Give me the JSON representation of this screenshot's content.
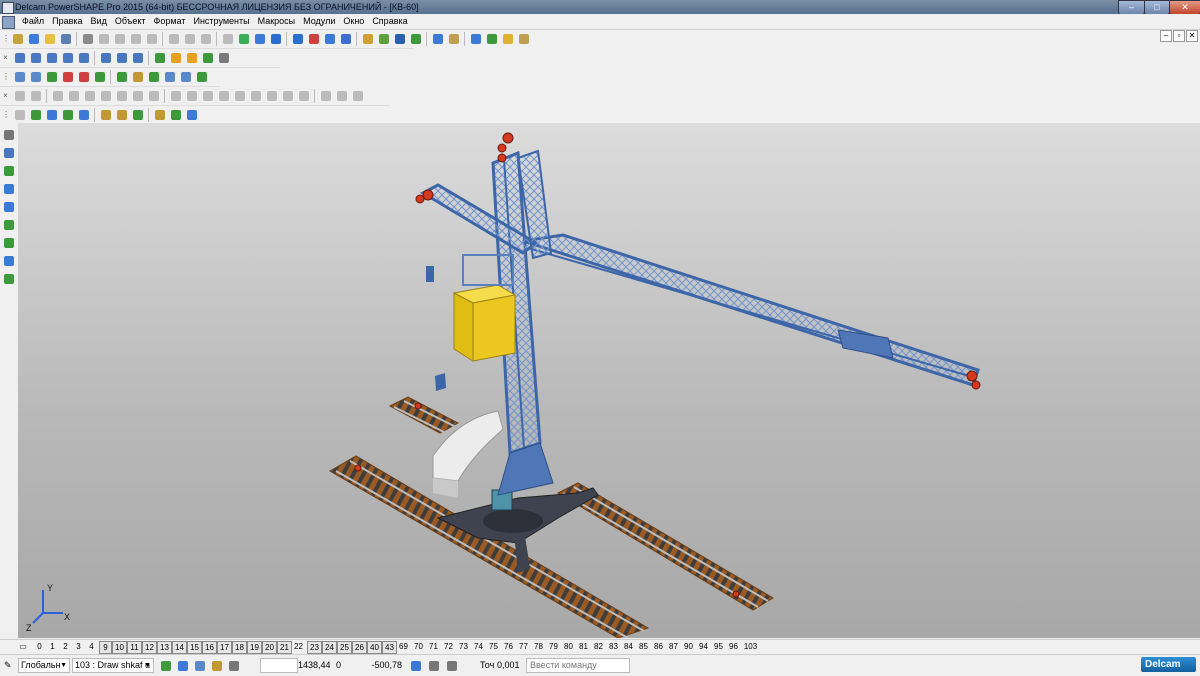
{
  "window": {
    "title": "Delcam PowerSHAPE Pro 2015 (64-bit) БЕССРОЧНАЯ ЛИЦЕНЗИЯ БЕЗ ОГРАНИЧЕНИЙ - [КВ-60]",
    "minimize": "–",
    "maximize": "□",
    "close": "✕"
  },
  "menu": [
    "Файл",
    "Правка",
    "Вид",
    "Объект",
    "Формат",
    "Инструменты",
    "Макросы",
    "Модули",
    "Окно",
    "Справка"
  ],
  "mdi_buttons": [
    "–",
    "▫",
    "✕"
  ],
  "toolbars": {
    "row1_grip": "⋮",
    "row2_close": "×",
    "row3_grip": "⋮",
    "row4_close": "×",
    "row5_grip": "⋮"
  },
  "toolbar_icons": {
    "row1": [
      "#c8a23c",
      "#3b7dd8",
      "#e8c040",
      "#5a7fb0",
      "#8a8a8a",
      "#bbbbbb",
      "#bbbbbb",
      "#bbbbbb",
      "#bbbbbb",
      "#bbbbbb",
      "#bbbbbb",
      "#bbbbbb",
      "#bbbbbb",
      "#3cae5a",
      "#3c7ad8",
      "#2a6fd0",
      "#2a6fd0",
      "#d04040",
      "#3c7ad8",
      "#3c6fd0",
      "#d0a030",
      "#60a040",
      "#2a5fb0",
      "#3c9a3c",
      "#3c7ad8",
      "#c0a050",
      "#3c7ad8",
      "#3c9a3c",
      "#e0b030",
      "#c0a050"
    ],
    "row2": [
      "#4a78c0",
      "#4a78c0",
      "#4a78c0",
      "#4a78c0",
      "#4a78c0",
      "#4a78c0",
      "#4a78c0",
      "#4a78c0",
      "#3c9a3c",
      "#e8a020",
      "#e8a020",
      "#3c9a3c",
      "#7a7a7a"
    ],
    "row3": [
      "#5a88c8",
      "#5a88c8",
      "#3c9a3c",
      "#d04040",
      "#d04040",
      "#3c9a3c",
      "#3c9a3c",
      "#c09a30",
      "#3c9a3c",
      "#5a88c8",
      "#5a88c8",
      "#3c9a3c"
    ],
    "row4": [
      "#bbbbbb",
      "#bbbbbb",
      "#bbbbbb",
      "#bbbbbb",
      "#bbbbbb",
      "#bbbbbb",
      "#bbbbbb",
      "#bbbbbb",
      "#bbbbbb",
      "#bbbbbb",
      "#bbbbbb",
      "#bbbbbb",
      "#bbbbbb",
      "#bbbbbb",
      "#bbbbbb",
      "#bbbbbb",
      "#bbbbbb",
      "#bbbbbb",
      "#bbbbbb",
      "#bbbbbb",
      "#bbbbbb"
    ],
    "row5": [
      "#bbbbbb",
      "#3c9a3c",
      "#3c7ad8",
      "#3c9a3c",
      "#3c7ad8",
      "#c09a30",
      "#c09a30",
      "#3c9a3c",
      "#c09a30",
      "#3c9a3c",
      "#3c7ad8"
    ],
    "left": [
      "#777777",
      "#4a78c0",
      "#3c9a3c",
      "#3c7ad8",
      "#3c7ad8",
      "#3c9a3c",
      "#3c9a3c",
      "#3c7ad8",
      "#3c9a3c"
    ]
  },
  "axis_triad": {
    "y": "Y",
    "x": "X",
    "z": "Z"
  },
  "levels": [
    {
      "n": "0",
      "boxed": false
    },
    {
      "n": "1",
      "boxed": false
    },
    {
      "n": "2",
      "boxed": false
    },
    {
      "n": "3",
      "boxed": false
    },
    {
      "n": "4",
      "boxed": false
    },
    {
      "n": "9",
      "boxed": true
    },
    {
      "n": "10",
      "boxed": true
    },
    {
      "n": "11",
      "boxed": true
    },
    {
      "n": "12",
      "boxed": true
    },
    {
      "n": "13",
      "boxed": true
    },
    {
      "n": "14",
      "boxed": true
    },
    {
      "n": "15",
      "boxed": true
    },
    {
      "n": "16",
      "boxed": true
    },
    {
      "n": "17",
      "boxed": true
    },
    {
      "n": "18",
      "boxed": true
    },
    {
      "n": "19",
      "boxed": true
    },
    {
      "n": "20",
      "boxed": true
    },
    {
      "n": "21",
      "boxed": true
    },
    {
      "n": "22",
      "boxed": false
    },
    {
      "n": "23",
      "boxed": true
    },
    {
      "n": "24",
      "boxed": true
    },
    {
      "n": "25",
      "boxed": true
    },
    {
      "n": "26",
      "boxed": true
    },
    {
      "n": "40",
      "boxed": true
    },
    {
      "n": "43",
      "boxed": true
    },
    {
      "n": "69",
      "boxed": false
    },
    {
      "n": "70",
      "boxed": false
    },
    {
      "n": "71",
      "boxed": false
    },
    {
      "n": "72",
      "boxed": false
    },
    {
      "n": "73",
      "boxed": false
    },
    {
      "n": "74",
      "boxed": false
    },
    {
      "n": "75",
      "boxed": false
    },
    {
      "n": "76",
      "boxed": false
    },
    {
      "n": "77",
      "boxed": false
    },
    {
      "n": "78",
      "boxed": false
    },
    {
      "n": "79",
      "boxed": false
    },
    {
      "n": "80",
      "boxed": false
    },
    {
      "n": "81",
      "boxed": false
    },
    {
      "n": "82",
      "boxed": false
    },
    {
      "n": "83",
      "boxed": false
    },
    {
      "n": "84",
      "boxed": false
    },
    {
      "n": "85",
      "boxed": false
    },
    {
      "n": "86",
      "boxed": false
    },
    {
      "n": "87",
      "boxed": false
    },
    {
      "n": "90",
      "boxed": false
    },
    {
      "n": "94",
      "boxed": false
    },
    {
      "n": "95",
      "boxed": false
    },
    {
      "n": "96",
      "boxed": false
    },
    {
      "n": "103",
      "boxed": false
    }
  ],
  "status": {
    "workplane": "Глобальн",
    "level": "103 : Draw shkaf u",
    "x": "1438,44",
    "y": "0",
    "z": "-500,78",
    "tolerance_label": "Точ",
    "tolerance": "0,001",
    "command_placeholder": "Ввести команду",
    "brand": "Delcam"
  },
  "colors": {
    "crane_blue": "#4f77b8",
    "crane_blue_dark": "#2f4f86",
    "cabin_yellow": "#e8c61d",
    "rail_brown": "#9a5a22",
    "wheel_red": "#d33a1f",
    "viewport_bg": "#bcbcbc"
  }
}
